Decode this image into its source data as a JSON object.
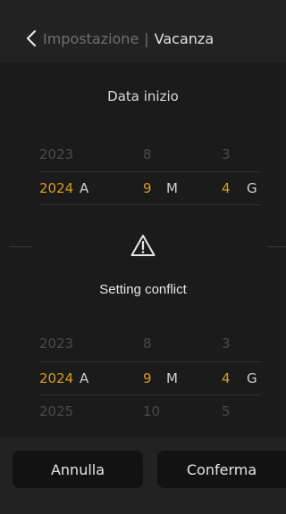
{
  "header": {
    "parent": "Impostazione",
    "separator": "|",
    "current": "Vacanza"
  },
  "start_picker": {
    "title": "Data inizio",
    "rows": [
      {
        "year": "2023",
        "month": "8",
        "day": "3",
        "selected": false
      },
      {
        "year": "2024",
        "month": "9",
        "day": "4",
        "selected": true
      }
    ],
    "units": {
      "year": "A",
      "month": "M",
      "day": "G"
    }
  },
  "conflict": {
    "icon": "warning-triangle-icon",
    "message": "Setting conflict"
  },
  "end_picker": {
    "rows": [
      {
        "year": "2023",
        "month": "8",
        "day": "3",
        "selected": false
      },
      {
        "year": "2024",
        "month": "9",
        "day": "4",
        "selected": true
      },
      {
        "year": "2025",
        "month": "10",
        "day": "5",
        "selected": false
      }
    ],
    "units": {
      "year": "A",
      "month": "M",
      "day": "G"
    }
  },
  "buttons": {
    "cancel": "Annulla",
    "confirm": "Conferma"
  },
  "colors": {
    "accent": "#d99c22",
    "background": "#1b1b1b",
    "bar": "#222222",
    "button": "#121212"
  }
}
